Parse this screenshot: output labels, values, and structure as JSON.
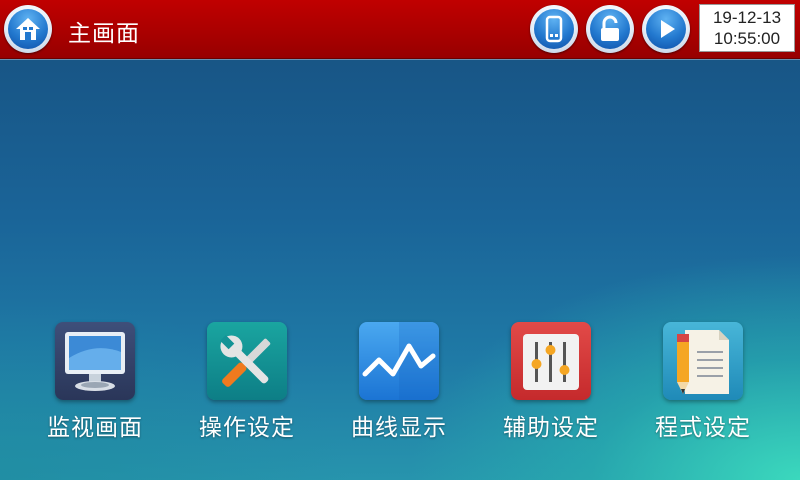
{
  "header": {
    "title": "主画面",
    "date": "19-12-13",
    "time": "10:55:00",
    "home_icon": "home-icon",
    "status_icons": [
      "usb-icon",
      "unlock-icon",
      "play-icon"
    ]
  },
  "menu": [
    {
      "label": "监视画面",
      "icon": "monitor-icon",
      "color": "#33436b"
    },
    {
      "label": "操作设定",
      "icon": "tools-icon",
      "color": "#149396"
    },
    {
      "label": "曲线显示",
      "icon": "curve-chart-icon",
      "color": "#2a8ae2"
    },
    {
      "label": "辅助设定",
      "icon": "sliders-icon",
      "color": "#d33a3a"
    },
    {
      "label": "程式设定",
      "icon": "document-pencil-icon",
      "color": "#2e9fc8"
    }
  ],
  "colors": {
    "header_bg": "#a80000",
    "accent_blue": "#2379cf"
  }
}
